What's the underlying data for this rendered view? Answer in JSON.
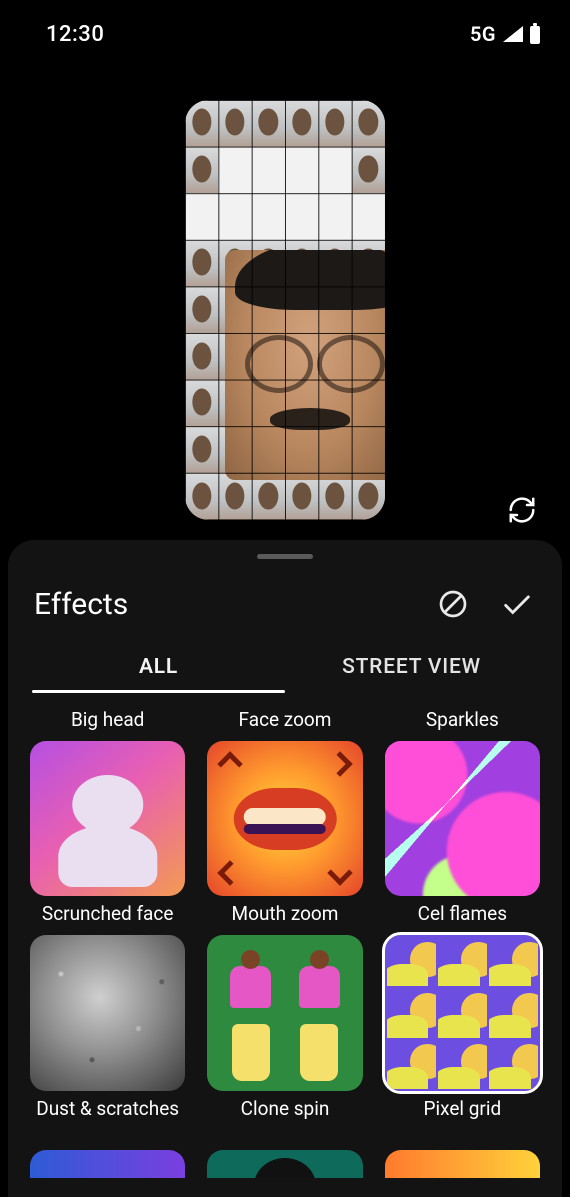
{
  "status": {
    "time": "12:30",
    "network": "5G"
  },
  "preview": {
    "reset_label": "reset"
  },
  "sheet": {
    "title": "Effects",
    "clear_label": "none",
    "confirm_label": "apply",
    "tabs": [
      {
        "id": "all",
        "label": "ALL",
        "active": true
      },
      {
        "id": "street",
        "label": "STREET VIEW",
        "active": false
      }
    ],
    "effects_row0_labels": [
      "Big head",
      "Face zoom",
      "Sparkles"
    ],
    "effects": [
      {
        "id": "scrunched",
        "label": "Scrunched face",
        "selected": false
      },
      {
        "id": "mouth",
        "label": "Mouth zoom",
        "selected": false
      },
      {
        "id": "cel",
        "label": "Cel flames",
        "selected": false
      },
      {
        "id": "dust",
        "label": "Dust & scratches",
        "selected": false
      },
      {
        "id": "clone",
        "label": "Clone spin",
        "selected": false
      },
      {
        "id": "pixel",
        "label": "Pixel grid",
        "selected": true
      }
    ]
  }
}
